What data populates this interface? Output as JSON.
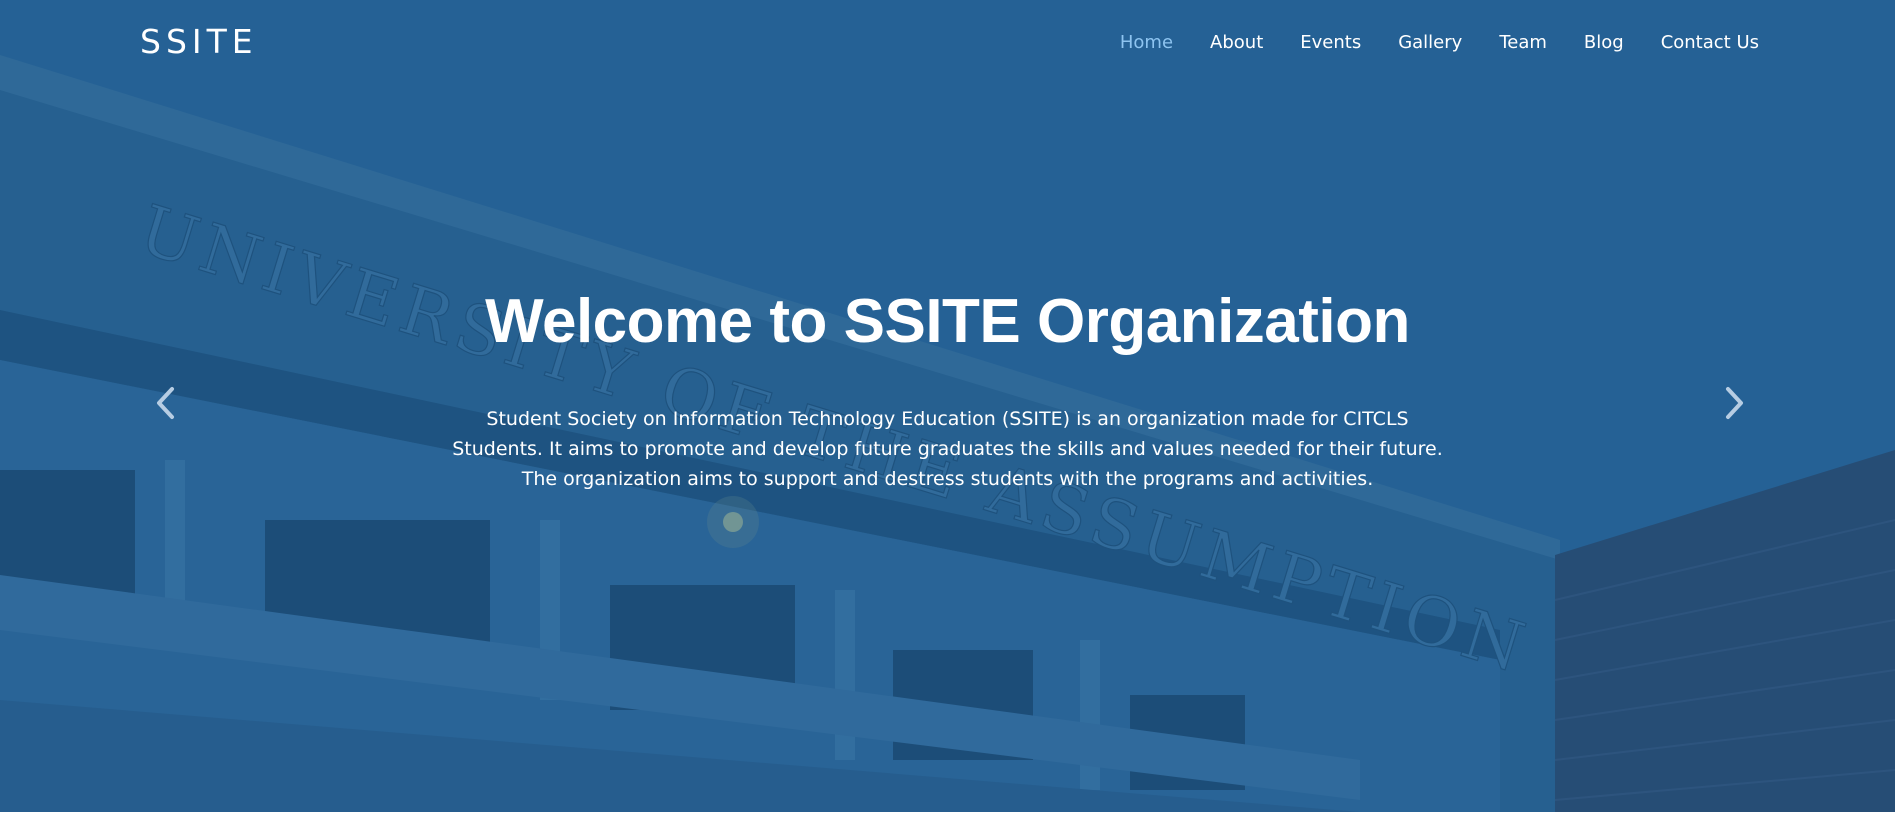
{
  "nav": {
    "brand": "SSITE",
    "items": [
      {
        "label": "Home",
        "active": true
      },
      {
        "label": "About",
        "active": false
      },
      {
        "label": "Events",
        "active": false
      },
      {
        "label": "Gallery",
        "active": false
      },
      {
        "label": "Team",
        "active": false
      },
      {
        "label": "Blog",
        "active": false
      },
      {
        "label": "Contact Us",
        "active": false
      }
    ]
  },
  "hero": {
    "title": "Welcome to SSITE Organization",
    "description_lines": [
      "Student Society on Information Technology Education (SSITE) is an organization made for CITCLS",
      "Students. It aims to promote and develop future graduates the skills and values needed for their future.",
      "The organization aims to support and destress students with the programs and activities."
    ],
    "building_sign": "UNIVERSITY OF THE ASSUMPTION",
    "prev_icon": "chevron-left-icon",
    "next_icon": "chevron-right-icon"
  },
  "colors": {
    "overlay": "#1e5c91",
    "active_nav": "#8ec4f0",
    "text": "#ffffff"
  }
}
